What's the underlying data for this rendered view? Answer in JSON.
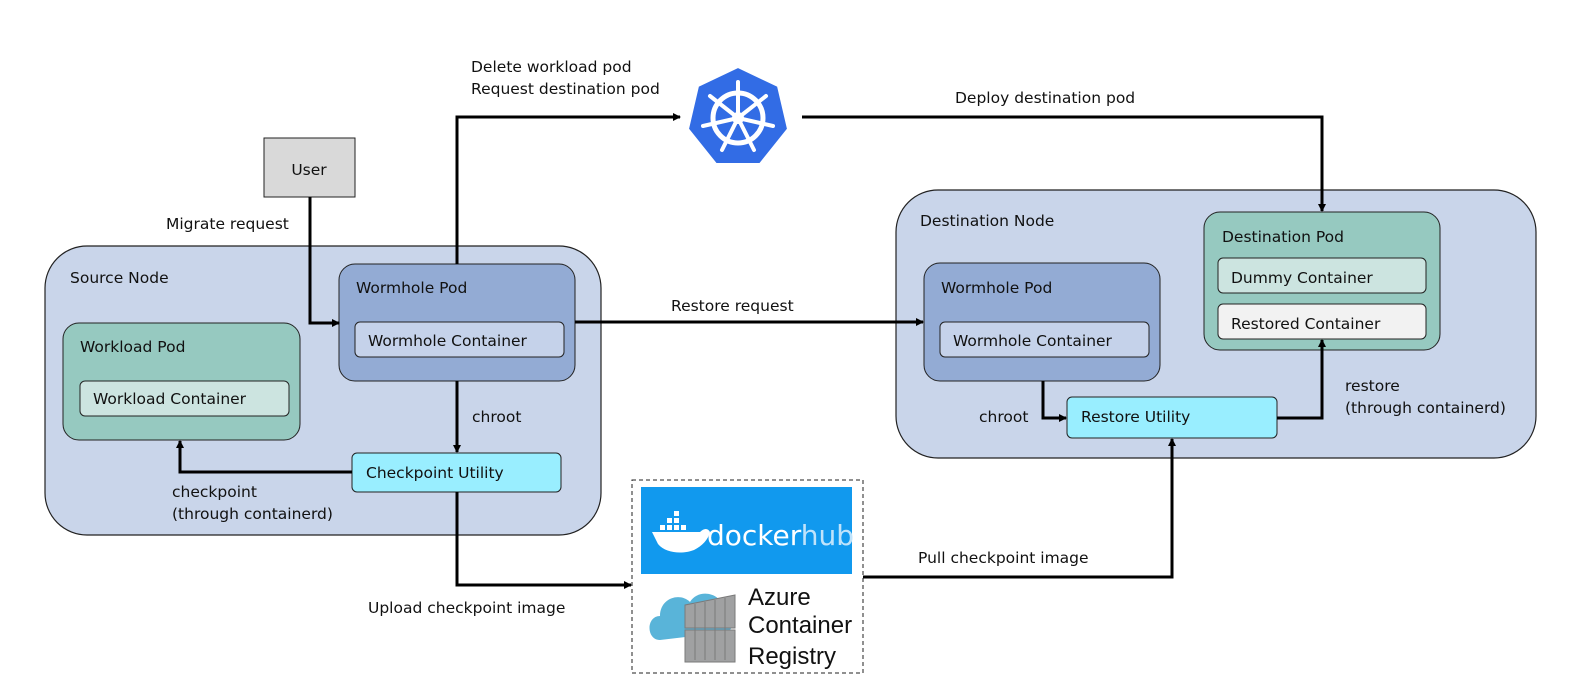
{
  "user": "User",
  "source_node": {
    "title": "Source Node",
    "workload_pod": "Workload Pod",
    "workload_container": "Workload Container",
    "wormhole_pod": "Wormhole Pod",
    "wormhole_container": "Wormhole Container",
    "checkpoint_utility": "Checkpoint Utility"
  },
  "destination_node": {
    "title": "Destination Node",
    "wormhole_pod": "Wormhole Pod",
    "wormhole_container": "Wormhole Container",
    "destination_pod": "Destination Pod",
    "dummy_container": "Dummy Container",
    "restored_container": "Restored Container",
    "restore_utility": "Restore Utility"
  },
  "labels": {
    "migrate_request": "Migrate request",
    "delete_workload_pod": "Delete workload pod",
    "request_destination_pod": "Request destination pod",
    "deploy_destination_pod": "Deploy destination pod",
    "restore_request": "Restore request",
    "chroot_source": "chroot",
    "chroot_dest": "chroot",
    "checkpoint": "checkpoint",
    "checkpoint_via": "(through containerd)",
    "restore": "restore",
    "restore_via": "(through containerd)",
    "upload": "Upload checkpoint image",
    "pull": "Pull checkpoint image"
  },
  "registry": {
    "docker_logo": "docker hub",
    "azure_line1": "Azure",
    "azure_line2": "Container",
    "azure_line3": "Registry"
  },
  "icons": {
    "kubernetes": "kubernetes-logo",
    "docker": "docker-hub-logo",
    "azure": "azure-container-registry-logo"
  },
  "colors": {
    "node": "#c9d5ea",
    "workload_pod": "#96c9c0",
    "wormhole_pod": "#93abd4",
    "utility": "#99eeff",
    "docker_blue": "#1199ee",
    "kubernetes_blue": "#326ce5"
  }
}
